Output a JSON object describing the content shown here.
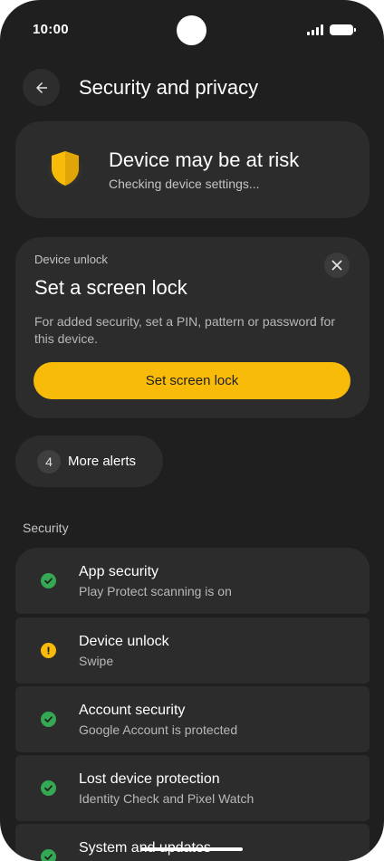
{
  "status_bar": {
    "time": "10:00"
  },
  "header": {
    "title": "Security and privacy",
    "back_icon": "arrow-back-icon"
  },
  "risk_card": {
    "icon": "shield-warning-icon",
    "title": "Device may be at risk",
    "subtitle": "Checking device settings..."
  },
  "unlock_card": {
    "label": "Device unlock",
    "title": "Set a screen lock",
    "description": "For added security, set a PIN, pattern or password for this device.",
    "button_label": "Set screen lock",
    "close_icon": "close-icon"
  },
  "alerts": {
    "count": "4",
    "label": "More alerts"
  },
  "security": {
    "section_title": "Security",
    "items": [
      {
        "title": "App security",
        "subtitle": "Play Protect scanning is on",
        "status": "ok"
      },
      {
        "title": "Device unlock",
        "subtitle": "Swipe",
        "status": "warning"
      },
      {
        "title": "Account security",
        "subtitle": "Google Account is protected",
        "status": "ok"
      },
      {
        "title": "Lost device protection",
        "subtitle": "Identity Check and Pixel Watch",
        "status": "ok"
      },
      {
        "title": "System and updates",
        "subtitle": "",
        "status": "ok"
      }
    ]
  },
  "colors": {
    "background": "#1f1f1f",
    "card": "#2c2c2c",
    "accent_yellow": "#f9bb0a",
    "ok_green": "#35a853"
  }
}
